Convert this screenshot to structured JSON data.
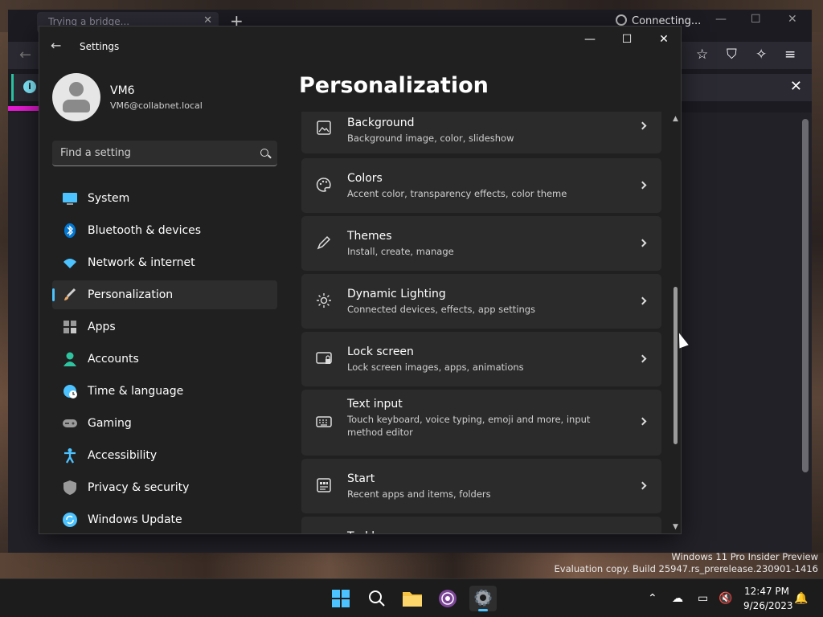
{
  "browser": {
    "tab_title": "Trying a bridge...",
    "tab_close": "✕",
    "new_tab": "+",
    "status": "Connecting...",
    "minimize": "—",
    "maximize": "☐",
    "close": "✕",
    "info_close": "✕",
    "info_icon": "i",
    "back": "←"
  },
  "settings": {
    "window_title": "Settings",
    "back": "←",
    "minimize": "—",
    "maximize": "☐",
    "close": "✕",
    "profile": {
      "name": "VM6",
      "email": "VM6@collabnet.local"
    },
    "search": {
      "placeholder": "Find a setting"
    },
    "nav": [
      {
        "label": "System",
        "icon": "monitor-icon",
        "color": "#4cc2ff"
      },
      {
        "label": "Bluetooth & devices",
        "icon": "bluetooth-icon",
        "color": "#0078d4"
      },
      {
        "label": "Network & internet",
        "icon": "wifi-icon",
        "color": "#4cc2ff"
      },
      {
        "label": "Personalization",
        "icon": "brush-icon",
        "color": "#e8a867",
        "selected": true
      },
      {
        "label": "Apps",
        "icon": "apps-icon",
        "color": "#9a9a9a"
      },
      {
        "label": "Accounts",
        "icon": "person-icon",
        "color": "#2ec4a0"
      },
      {
        "label": "Time & language",
        "icon": "globe-clock-icon",
        "color": "#4cc2ff"
      },
      {
        "label": "Gaming",
        "icon": "gamepad-icon",
        "color": "#9a9a9a"
      },
      {
        "label": "Accessibility",
        "icon": "accessibility-icon",
        "color": "#4cc2ff"
      },
      {
        "label": "Privacy & security",
        "icon": "shield-icon",
        "color": "#9a9a9a"
      },
      {
        "label": "Windows Update",
        "icon": "update-icon",
        "color": "#4cc2ff"
      }
    ],
    "page_title": "Personalization",
    "cards": [
      {
        "title": "Background",
        "subtitle": "Background image, color, slideshow",
        "icon": "image-icon"
      },
      {
        "title": "Colors",
        "subtitle": "Accent color, transparency effects, color theme",
        "icon": "palette-icon"
      },
      {
        "title": "Themes",
        "subtitle": "Install, create, manage",
        "icon": "pen-icon"
      },
      {
        "title": "Dynamic Lighting",
        "subtitle": "Connected devices, effects, app settings",
        "icon": "light-icon"
      },
      {
        "title": "Lock screen",
        "subtitle": "Lock screen images, apps, animations",
        "icon": "lock-screen-icon"
      },
      {
        "title": "Text input",
        "subtitle": "Touch keyboard, voice typing, emoji and more, input method editor",
        "icon": "keyboard-icon"
      },
      {
        "title": "Start",
        "subtitle": "Recent apps and items, folders",
        "icon": "start-icon"
      },
      {
        "title": "Taskbar",
        "subtitle": "",
        "icon": "taskbar-icon"
      }
    ],
    "scroll_up": "▲",
    "scroll_down": "▼"
  },
  "watermark": {
    "line1": "Windows 11 Pro Insider Preview",
    "line2": "Evaluation copy. Build 25947.rs_prerelease.230901-1416"
  },
  "taskbar": {
    "time": "12:47 PM",
    "date": "9/26/2023",
    "tray_chevron": "⌃"
  }
}
